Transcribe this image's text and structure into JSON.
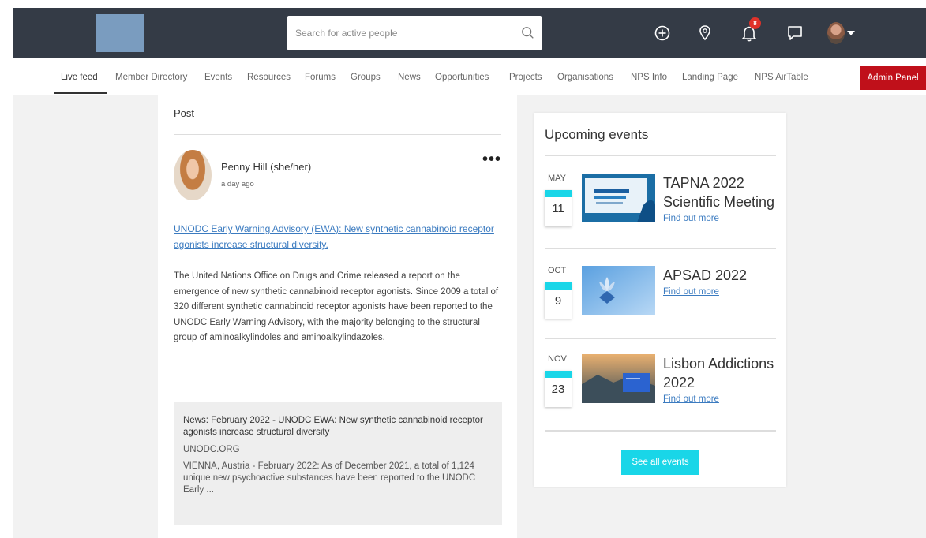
{
  "header": {
    "search_placeholder": "Search for active people",
    "notification_count": "8"
  },
  "nav": {
    "items": [
      "Live feed",
      "Member Directory",
      "Events",
      "Resources",
      "Forums",
      "Groups",
      "News",
      "Opportunities",
      "Projects",
      "Organisations",
      "NPS Info",
      "Landing Page",
      "NPS AirTable"
    ],
    "admin_label": "Admin Panel"
  },
  "post": {
    "heading": "Post",
    "author": "Penny Hill (she/her)",
    "time": "a day ago",
    "link_text": "UNODC Early Warning Advisory (EWA): New synthetic cannabinoid receptor agonists increase structural diversity.",
    "body": "The United Nations Office on Drugs and Crime released a report on the emergence of new synthetic cannabinoid receptor agonists. Since 2009 a total of 320 different synthetic cannabinoid receptor agonists have been reported to the UNODC Early Warning Advisory, with the majority belonging to the structural group of aminoalkylindoles and aminoalkylindazoles.",
    "preview": {
      "title": "News: February 2022 - UNODC EWA: New synthetic cannabinoid receptor agonists increase structural diversity",
      "domain": "UNODC.ORG",
      "description": "VIENNA, Austria - February 2022: As of December 2021, a total of 1,124 unique new psychoactive substances have been reported to the UNODC Early ..."
    }
  },
  "events": {
    "heading": "Upcoming events",
    "items": [
      {
        "month": "MAY",
        "day": "11",
        "title": "TAPNA 2022 Scientific Meeting",
        "link": "Find out more"
      },
      {
        "month": "OCT",
        "day": "9",
        "title": "APSAD 2022",
        "link": "Find out more"
      },
      {
        "month": "NOV",
        "day": "23",
        "title": "Lisbon Addictions 2022",
        "link": "Find out more"
      }
    ],
    "see_all": "See all events"
  },
  "colors": {
    "topbar": "#343b46",
    "admin": "#c0101a",
    "accent_cyan": "#19d6e8",
    "link": "#3b7bc0"
  }
}
